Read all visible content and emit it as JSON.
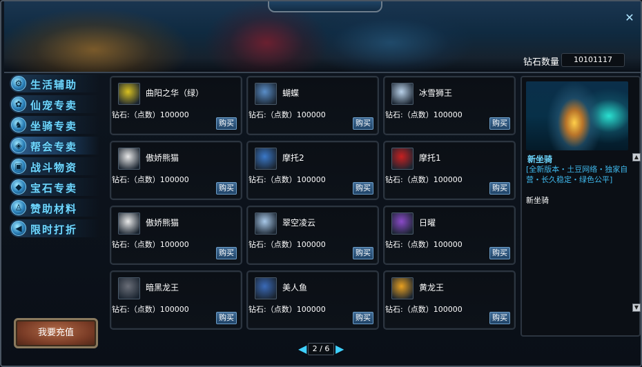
{
  "header": {
    "diamond_label": "钻石数量",
    "diamond_value": "10101117",
    "close_icon": "close-icon"
  },
  "sidebar": {
    "items": [
      {
        "label": "生活辅助",
        "icon": "gear-icon",
        "active": false
      },
      {
        "label": "仙宠专卖",
        "icon": "paw-icon",
        "active": false
      },
      {
        "label": "坐骑专卖",
        "icon": "horse-icon",
        "active": false
      },
      {
        "label": "帮会专卖",
        "icon": "shield-icon",
        "active": true
      },
      {
        "label": "战斗物资",
        "icon": "box-icon",
        "active": false
      },
      {
        "label": "宝石专卖",
        "icon": "gem-icon",
        "active": false
      },
      {
        "label": "赞助材料",
        "icon": "person-icon",
        "active": false
      },
      {
        "label": "限时打折",
        "icon": "megaphone-icon",
        "active": false
      }
    ],
    "recharge_label": "我要充值"
  },
  "products": [
    {
      "name": "曲阳之华（绿）",
      "price": "钻石:（点数）100000",
      "buy": "购买",
      "color": "#d8c020"
    },
    {
      "name": "蝴蝶",
      "price": "钻石:（点数）100000",
      "buy": "购买",
      "color": "#5a8ec8"
    },
    {
      "name": "冰雪狮王",
      "price": "钻石:（点数）100000",
      "buy": "购买",
      "color": "#b8d0e8"
    },
    {
      "name": "傲娇熊猫",
      "price": "钻石:（点数）100000",
      "buy": "购买",
      "color": "#e8e8e8"
    },
    {
      "name": "摩托2",
      "price": "钻石:（点数）100000",
      "buy": "购买",
      "color": "#3a78c8"
    },
    {
      "name": "摩托1",
      "price": "钻石:（点数）100000",
      "buy": "购买",
      "color": "#c82020"
    },
    {
      "name": "傲娇熊猫",
      "price": "钻石:（点数）100000",
      "buy": "购买",
      "color": "#e8e8e8"
    },
    {
      "name": "翠空凌云",
      "price": "钻石:（点数）100000",
      "buy": "购买",
      "color": "#a8c8e8"
    },
    {
      "name": "日曜",
      "price": "钻石:（点数）100000",
      "buy": "购买",
      "color": "#8a4ac8"
    },
    {
      "name": "暗黑龙王",
      "price": "钻石:（点数）100000",
      "buy": "购买",
      "color": "#6a6e78"
    },
    {
      "name": "美人鱼",
      "price": "钻石:（点数）100000",
      "buy": "购买",
      "color": "#3a6ab8"
    },
    {
      "name": "黄龙王",
      "price": "钻石:（点数）100000",
      "buy": "购买",
      "color": "#e8a020"
    }
  ],
  "preview": {
    "title": "新坐骑",
    "description": "[全新版本・土豆网络・独家自营・长久稳定・绿色公平]",
    "subtitle": "新坐骑"
  },
  "pager": {
    "text": "2 / 6"
  }
}
